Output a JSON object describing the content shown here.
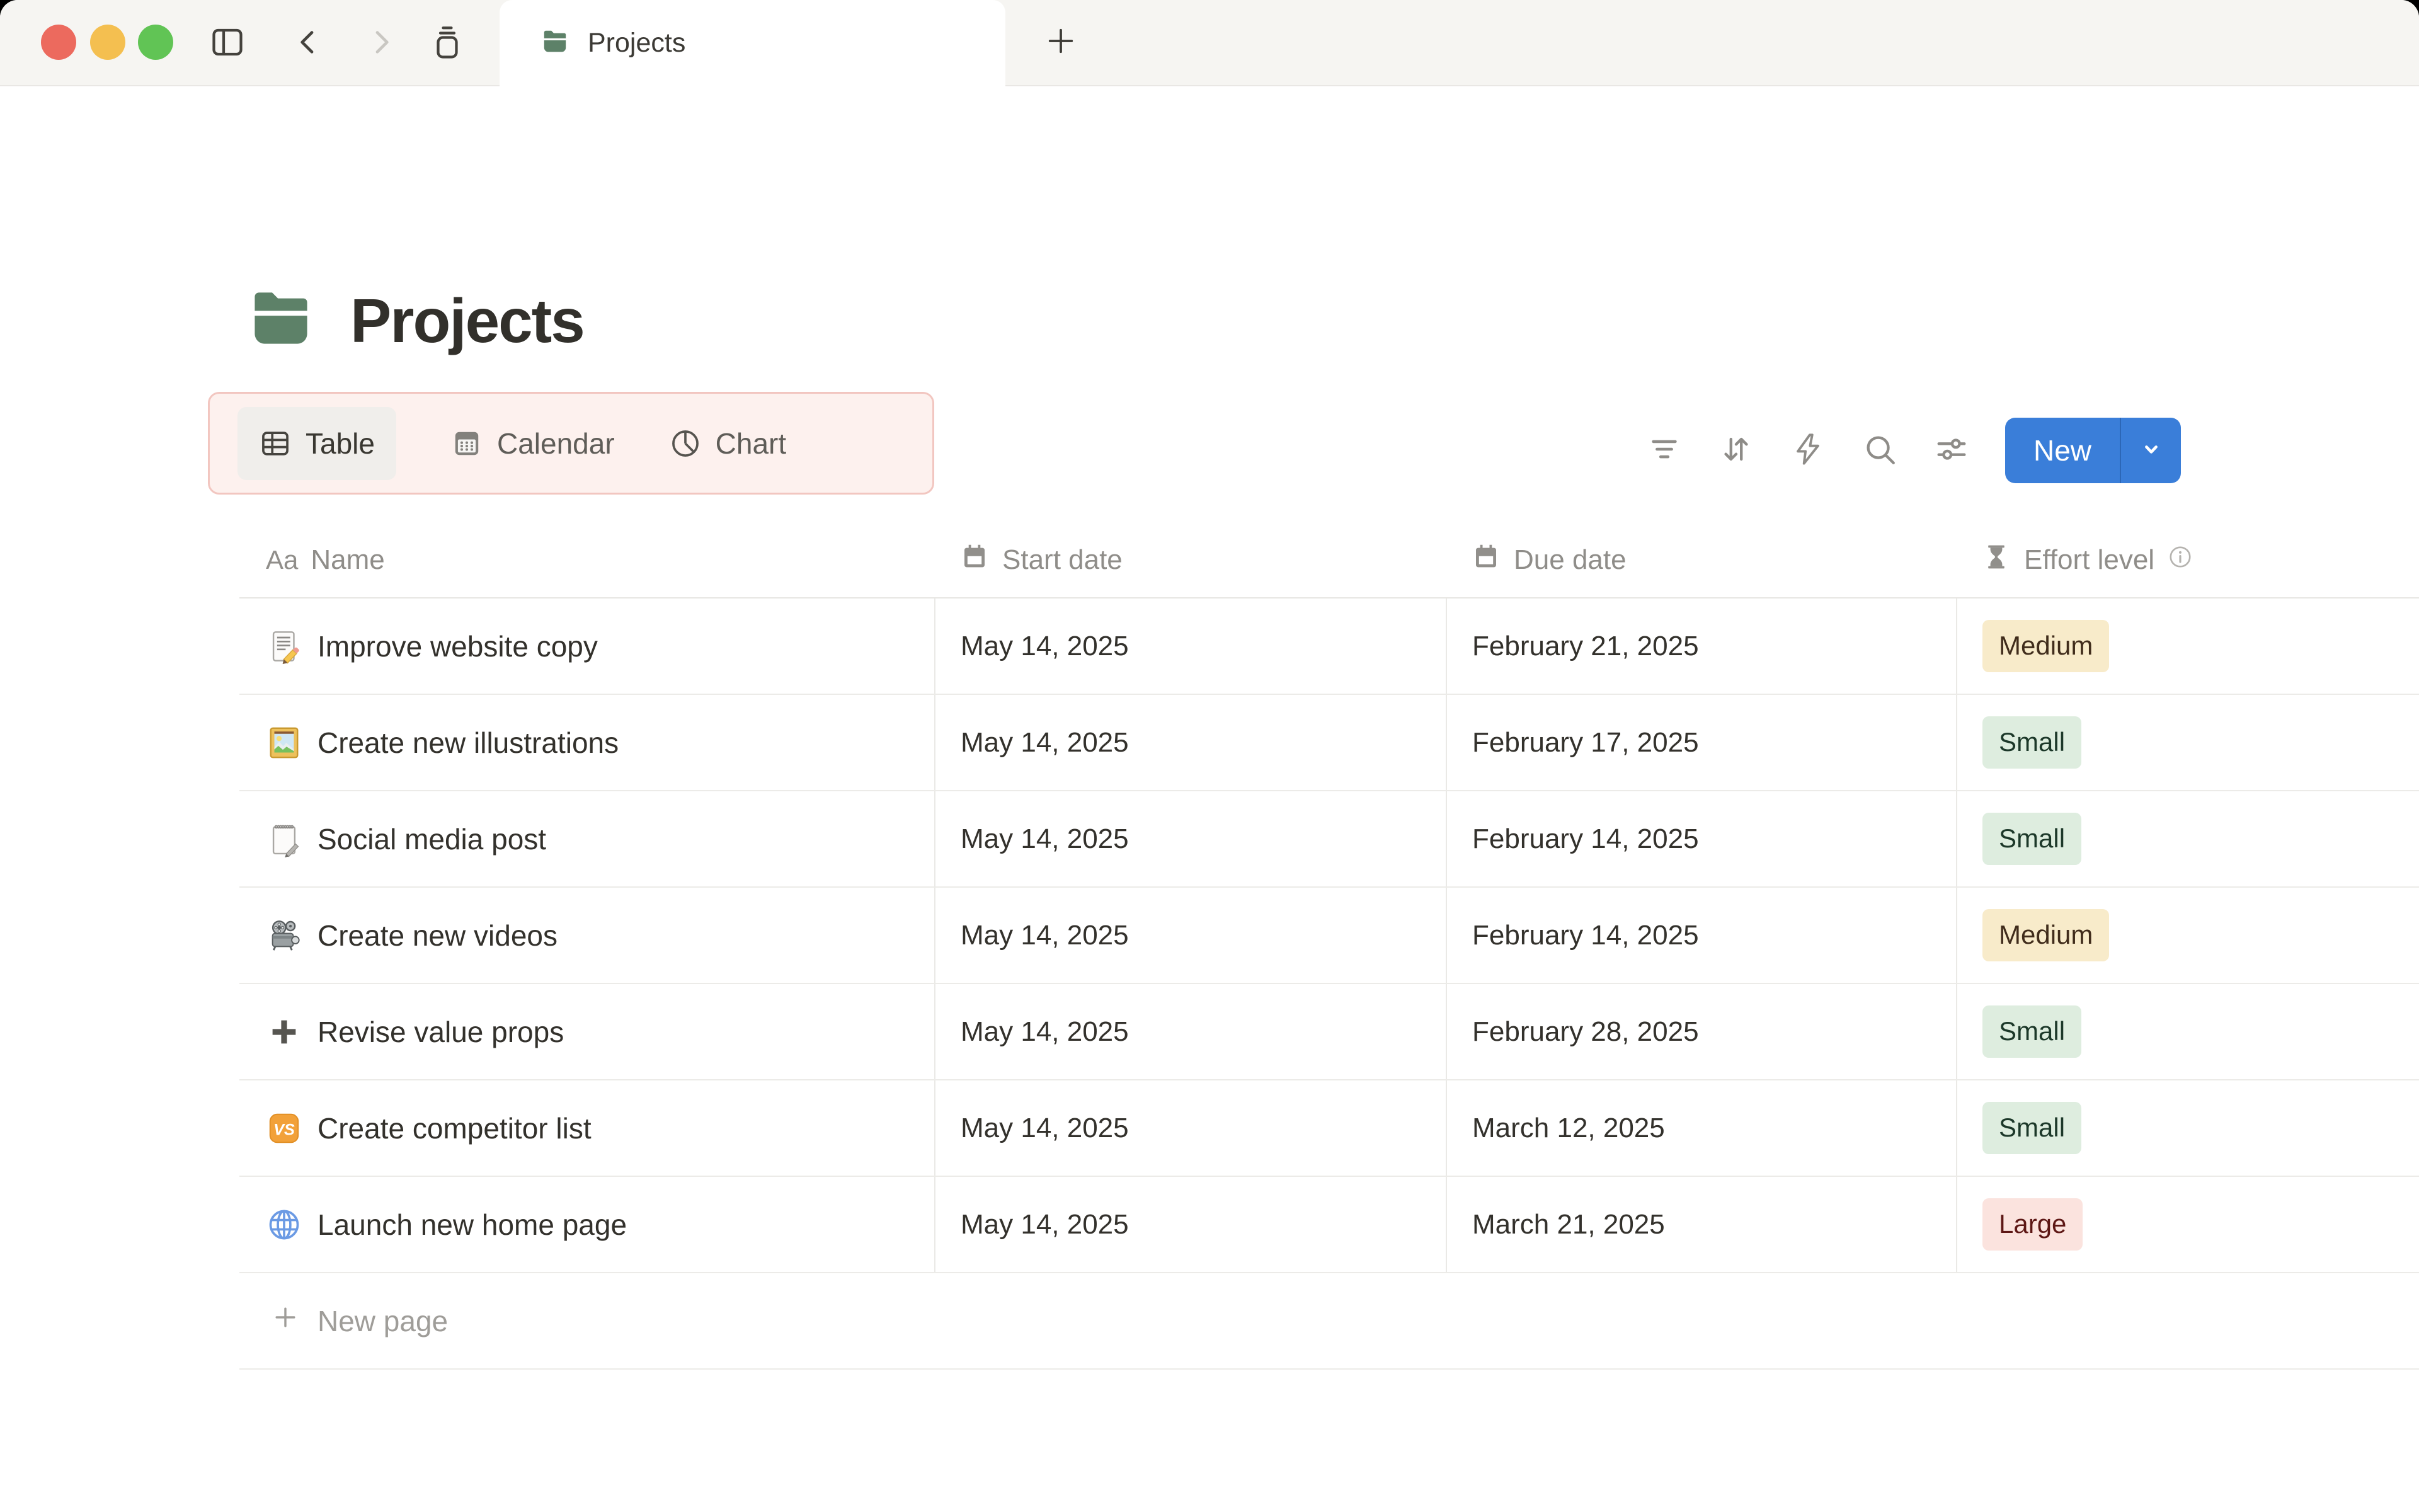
{
  "window": {
    "tab": {
      "icon": "folder-icon",
      "label": "Projects"
    }
  },
  "page": {
    "icon": "folder-icon",
    "title": "Projects"
  },
  "views": {
    "tabs": [
      {
        "label": "Table",
        "icon": "table-view-icon",
        "active": true
      },
      {
        "label": "Calendar",
        "icon": "calendar-view-icon",
        "active": false
      },
      {
        "label": "Chart",
        "icon": "pie-chart-view-icon",
        "active": false
      }
    ],
    "highlight_bg": "#fdf1ee",
    "highlight_border": "#f2c6c0"
  },
  "toolbar": {
    "icons": [
      "filter",
      "sort",
      "lightning",
      "search",
      "sliders"
    ],
    "new_button": {
      "label": "New",
      "color": "#3a7ed9"
    }
  },
  "table": {
    "columns": [
      {
        "label": "Name",
        "icon": "text-icon"
      },
      {
        "label": "Start date",
        "icon": "calendar-icon"
      },
      {
        "label": "Due date",
        "icon": "calendar-icon"
      },
      {
        "label": "Effort level",
        "icon": "hourglass-icon",
        "info_icon": true
      }
    ],
    "rows": [
      {
        "icon": "memo",
        "name": "Improve website copy",
        "start": "May 14, 2025",
        "due": "February 21, 2025",
        "effort": "Medium"
      },
      {
        "icon": "picture",
        "name": "Create new illustrations",
        "start": "May 14, 2025",
        "due": "February 17, 2025",
        "effort": "Small"
      },
      {
        "icon": "notepad",
        "name": "Social media post",
        "start": "May 14, 2025",
        "due": "February 14, 2025",
        "effort": "Small"
      },
      {
        "icon": "projector",
        "name": "Create new videos",
        "start": "May 14, 2025",
        "due": "February 14, 2025",
        "effort": "Medium"
      },
      {
        "icon": "plus",
        "name": "Revise value props",
        "start": "May 14, 2025",
        "due": "February 28, 2025",
        "effort": "Small"
      },
      {
        "icon": "vs",
        "name": "Create competitor list",
        "start": "May 14, 2025",
        "due": "March 12, 2025",
        "effort": "Small"
      },
      {
        "icon": "globe",
        "name": "Launch new home page",
        "start": "May 14, 2025",
        "due": "March 21, 2025",
        "effort": "Large"
      }
    ],
    "new_page_label": "New page"
  },
  "effort_styles": {
    "Small": {
      "bg": "#deeddf",
      "fg": "#1c3829"
    },
    "Medium": {
      "bg": "#f8ebca",
      "fg": "#402c1b"
    },
    "Large": {
      "bg": "#fbe3de",
      "fg": "#5d1715"
    }
  },
  "colors": {
    "folder_green": "#5d8168",
    "accent_blue": "#3a7ed9",
    "titlebar_bg": "#f6f5f2",
    "traffic_red": "#ec6a5e",
    "traffic_yellow": "#f4bf50",
    "traffic_green": "#61c455"
  }
}
